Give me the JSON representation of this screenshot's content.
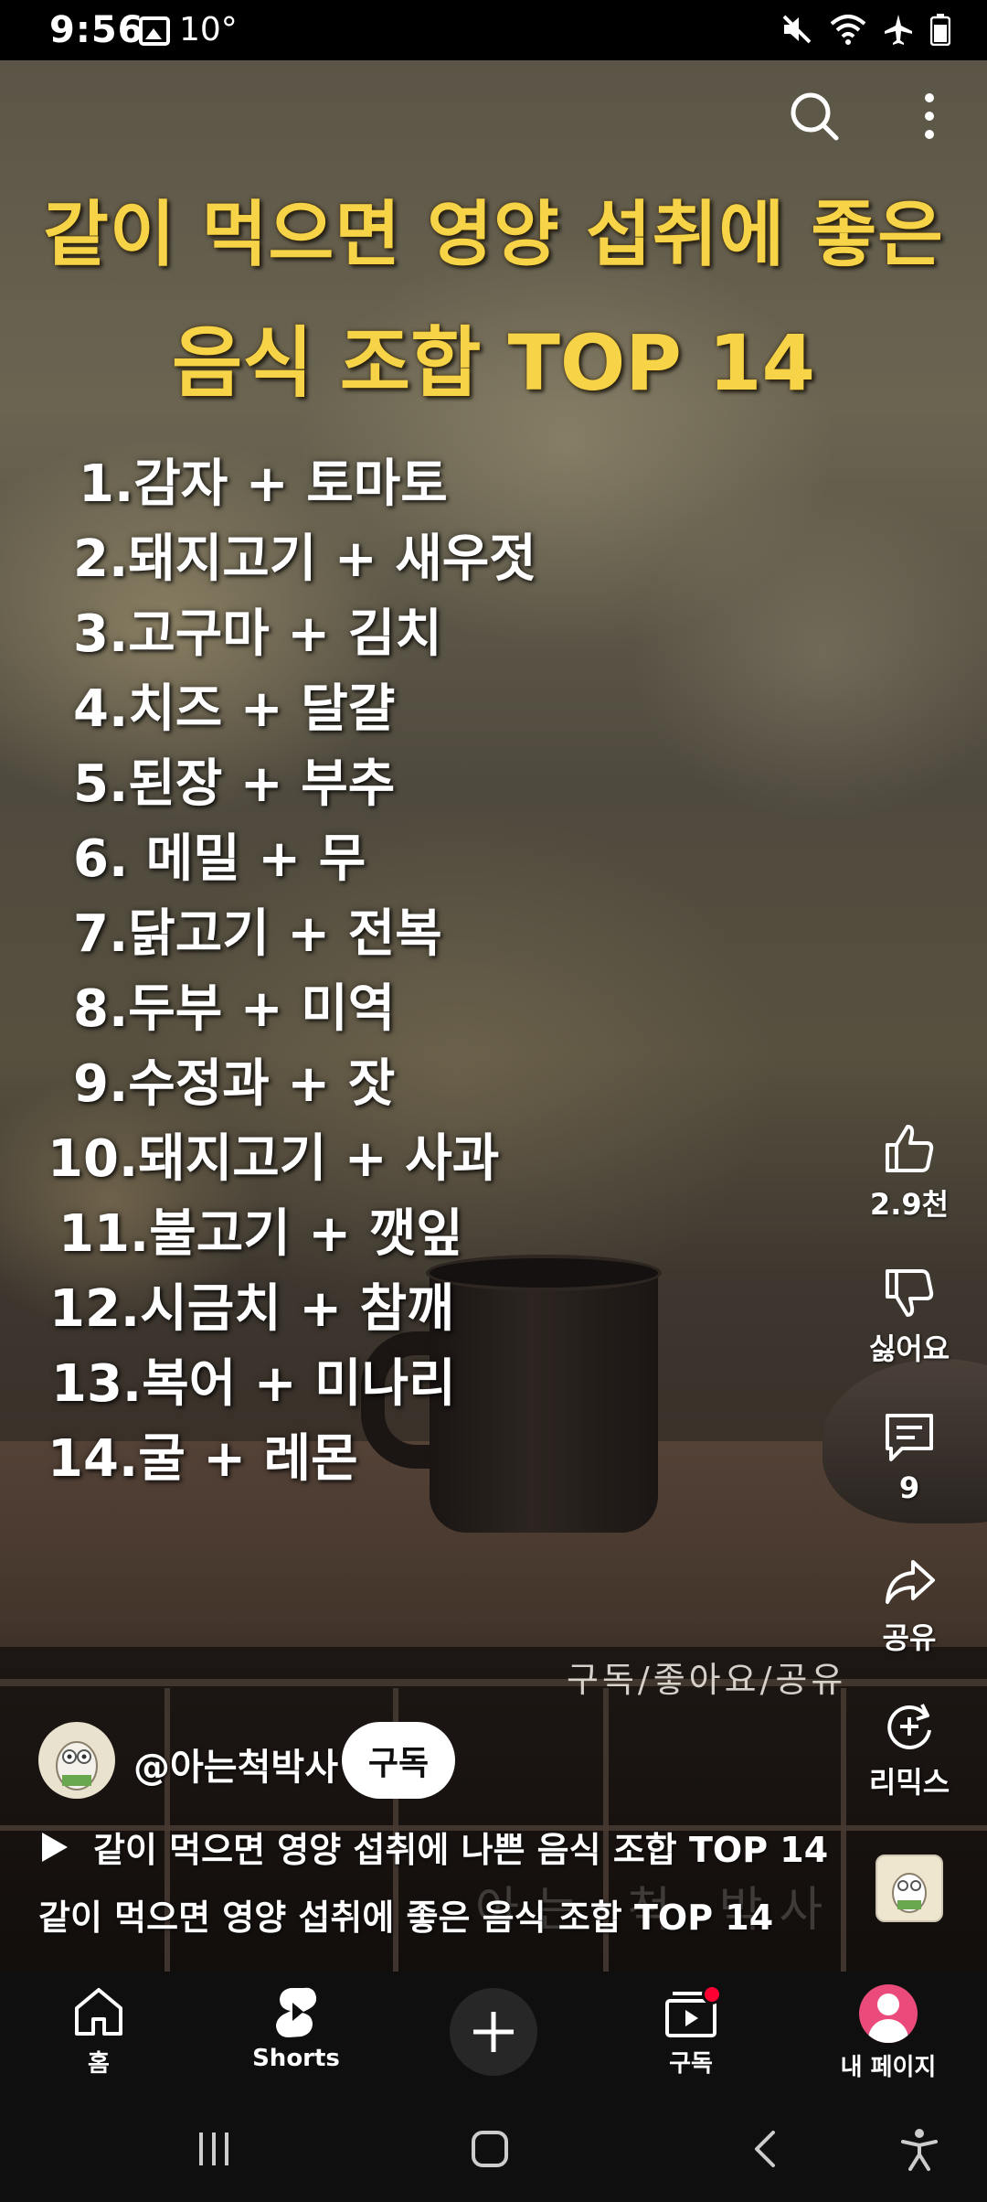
{
  "status_bar": {
    "time": "9:56",
    "temperature": "10°",
    "icons": [
      "gallery-icon",
      "mute-icon",
      "wifi-icon",
      "airplane-icon",
      "battery-icon"
    ]
  },
  "video": {
    "overlay_title_line1": "같이 먹으면 영양 섭취에 좋은",
    "overlay_title_line2": "음식 조합 TOP 14",
    "title_color": "#f7d447",
    "list": [
      "1.감자 + 토마토",
      "2.돼지고기 + 새우젓",
      "3.고구마 + 김치",
      "4.치즈 + 달걀",
      "5.된장 + 부추",
      "6.  메밀 + 무",
      "7.닭고기 + 전복",
      "8.두부 + 미역",
      "9.수정과 + 잣",
      "10.돼지고기 + 사과",
      "11.불고기 + 깻잎",
      "12.시금치 + 참깨",
      "13.복어 + 미나리",
      "14.굴 + 레몬"
    ],
    "watermark_text": "구독/좋아요/공유",
    "watermark_faint": "아는 척 박사"
  },
  "top_actions": {
    "search_icon": "search-icon",
    "more_icon": "more-vertical-icon"
  },
  "rail": {
    "like_count": "2.9천",
    "dislike_label": "싫어요",
    "comment_count": "9",
    "share_label": "공유",
    "remix_label": "리믹스"
  },
  "channel": {
    "handle": "@아는척박사",
    "subscribe_label": "구독"
  },
  "related_video": "같이 먹으면 영양 섭취에 나쁜 음식 조합 TOP 14",
  "caption": "같이 먹으면 영양 섭취에 좋은 음식 조합 TOP 14",
  "bottom_nav": {
    "home": "홈",
    "shorts": "Shorts",
    "subscriptions": "구독",
    "my_page": "내 페이지"
  },
  "colors": {
    "subscribe_bg": "#ffffff",
    "notification_dot": "#ff0033",
    "profile_avatar": "#ea4b7a",
    "nav_bg": "#0f0f0f"
  }
}
